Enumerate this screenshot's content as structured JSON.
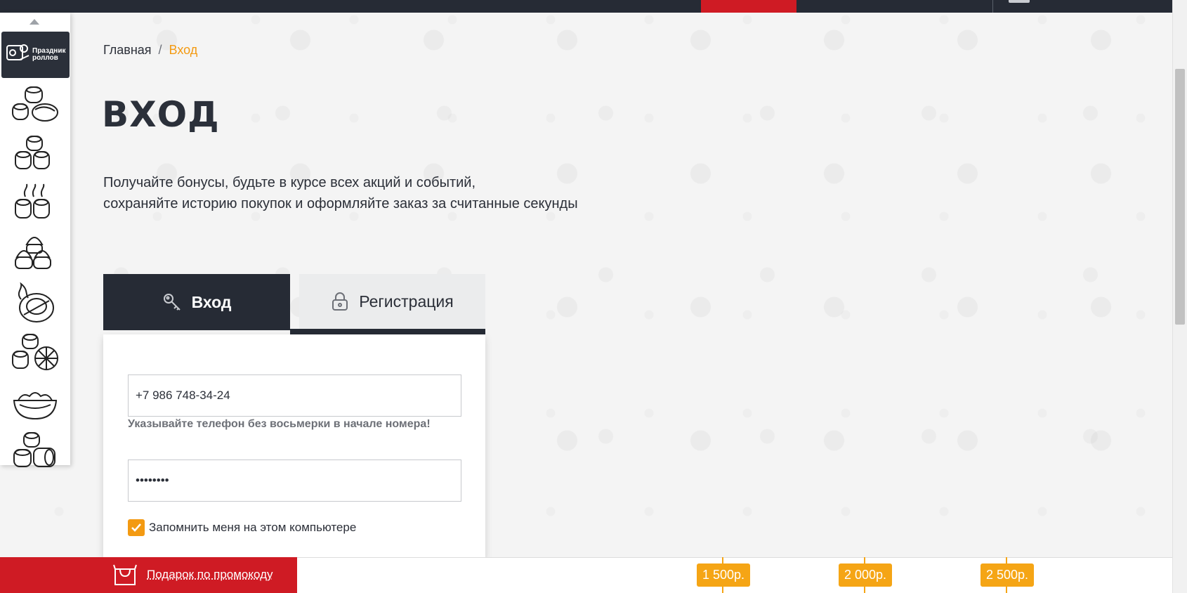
{
  "breadcrumb": {
    "home": "Главная",
    "separator": "/",
    "current": "Вход"
  },
  "page_title": "Вход",
  "intro": {
    "line1": "Получайте бонусы, будьте в курсе всех акций и событий,",
    "line2": "сохраняйте историю покупок и оформляйте заказ за считанные секунды"
  },
  "sidebar": {
    "promo_label": "Праздник роллов",
    "categories": [
      "sushi-icon",
      "rolls-icon",
      "hot-rolls-icon",
      "baked-rolls-icon",
      "spicy-roll-icon",
      "roll-set-icon",
      "noodles-icon",
      "roll-combo-icon"
    ]
  },
  "tabs": {
    "login": "Вход",
    "register": "Регистрация"
  },
  "form": {
    "phone_value": "+7 986 748-34-24",
    "phone_hint": "Указывайте телефон без восьмерки в начале номера!",
    "password_value": "••••••••",
    "remember_label": "Запомнить меня на этом компьютере",
    "remember_checked": true
  },
  "bottom_bar": {
    "gift_label": "Подарок по промокоду",
    "tiers": [
      "1 500р.",
      "2 000р.",
      "2 500р."
    ]
  },
  "colors": {
    "dark": "#262b35",
    "red": "#cf1b24",
    "accent": "#f39a12"
  }
}
